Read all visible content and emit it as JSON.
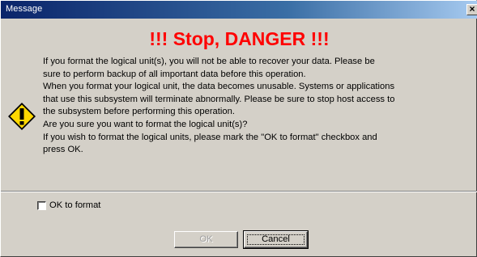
{
  "window": {
    "title": "Message",
    "close_glyph": "×"
  },
  "heading": "!!! Stop, DANGER !!!",
  "icon": "warning-icon",
  "message_lines": [
    "If you format the logical unit(s), you will not be able to recover your data. Please be",
    "sure to perform backup of all important data before this operation.",
    "When you format your logical unit, the data becomes unusable. Systems or applications",
    "that use this subsystem will terminate abnormally. Please be sure to stop host access to",
    "the subsystem before performing this operation.",
    "Are you sure you want to format the logical unit(s)?",
    "If you wish to format the logical units, please mark the \"OK to format\" checkbox and",
    "press OK."
  ],
  "checkbox": {
    "label": "OK to format",
    "checked": false
  },
  "buttons": {
    "ok_label": "OK",
    "ok_enabled": false,
    "cancel_label": "Cancel"
  },
  "colors": {
    "danger": "#ff0000",
    "titlebar": "#0a246a",
    "dialog_bg": "#d4d0c8"
  }
}
